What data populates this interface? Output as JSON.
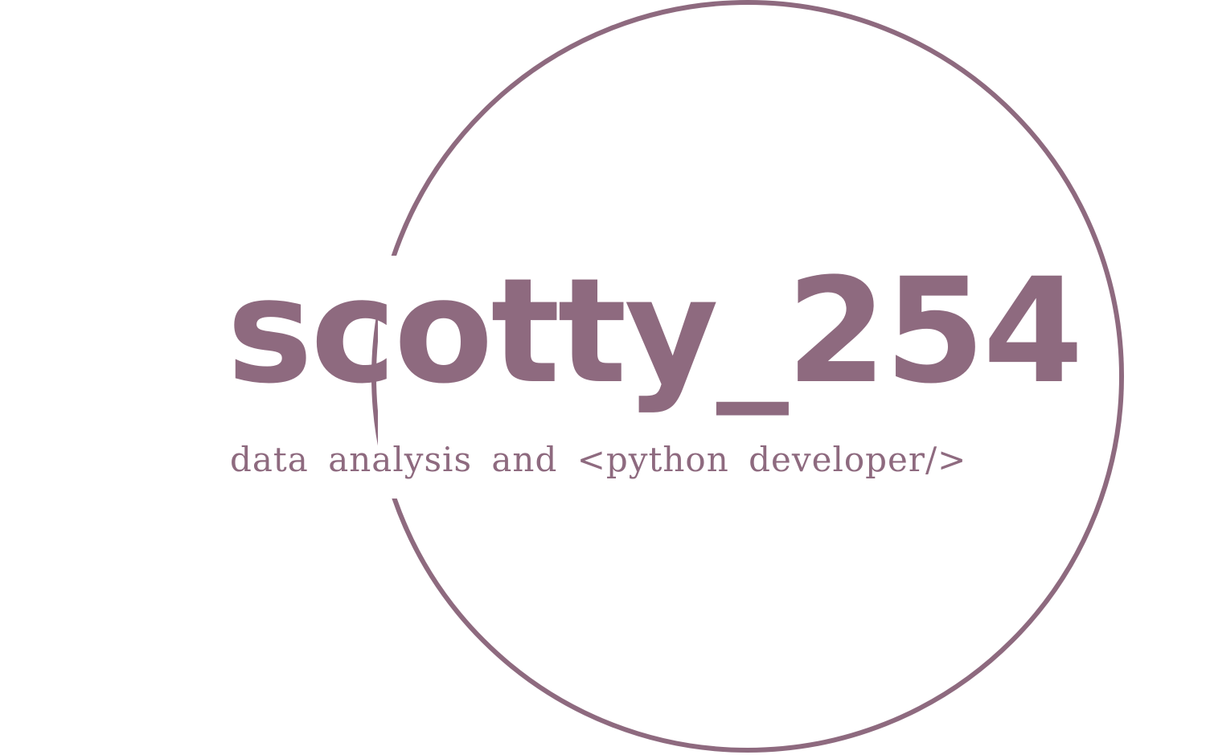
{
  "logo": {
    "title": "scotty_254",
    "tagline": "data analysis and <python developer/>"
  },
  "colors": {
    "brand": "#8e6a7f",
    "background": "#ffffff"
  }
}
